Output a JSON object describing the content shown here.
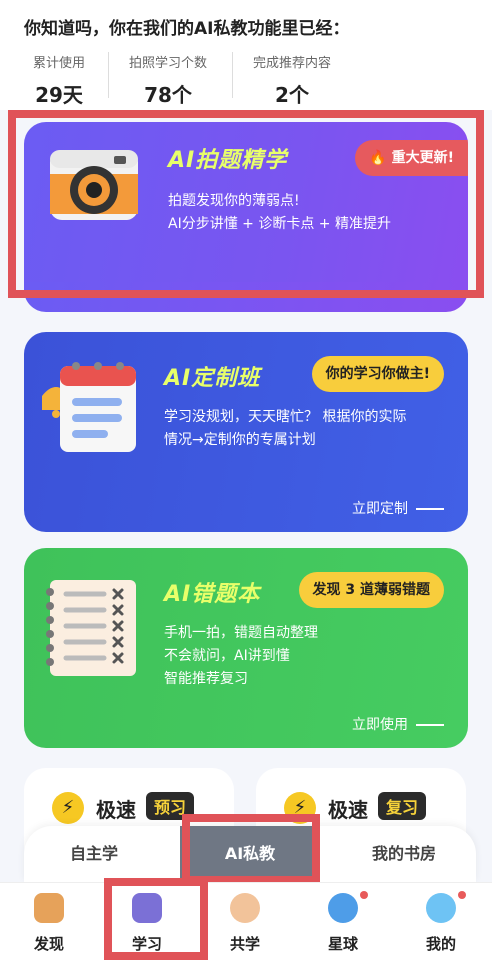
{
  "stats": {
    "title": "你知道吗，你在我们的AI私教功能里已经：",
    "items": [
      {
        "label": "累计使用",
        "value": "29天"
      },
      {
        "label": "拍照学习个数",
        "value": "78个"
      },
      {
        "label": "完成推荐内容",
        "value": "2个"
      }
    ]
  },
  "cards": {
    "photo": {
      "title": "AI拍题精学",
      "badge": "重大更新!",
      "desc": [
        "拍题发现你的薄弱点!",
        "AI分步讲懂 + 诊断卡点 + 精准提升"
      ]
    },
    "custom_class": {
      "title": "AI定制班",
      "badge": "你的学习你做主!",
      "desc": [
        "学习没规划，天天瞎忙？ 根据你的实际",
        "情况→定制你的专属计划"
      ],
      "cta": "立即定制"
    },
    "wrong_book": {
      "title": "AI错题本",
      "badge": "发现 3 道薄弱错题",
      "desc": [
        "手机一拍，错题自动整理",
        "不会就问，AI讲到懂",
        "智能推荐复习"
      ],
      "cta": "立即使用"
    }
  },
  "quick": [
    {
      "label": "极速",
      "tag": "预习"
    },
    {
      "label": "极速",
      "tag": "复习"
    }
  ],
  "segments": [
    "自主学",
    "AI私教",
    "我的书房"
  ],
  "nav": [
    "发现",
    "学习",
    "共学",
    "星球",
    "我的"
  ],
  "colors": {
    "accent_red": "#e05358",
    "purple": "#7a55f0",
    "blue": "#4160e6",
    "green": "#46cc61",
    "yellow": "#f6c823"
  }
}
